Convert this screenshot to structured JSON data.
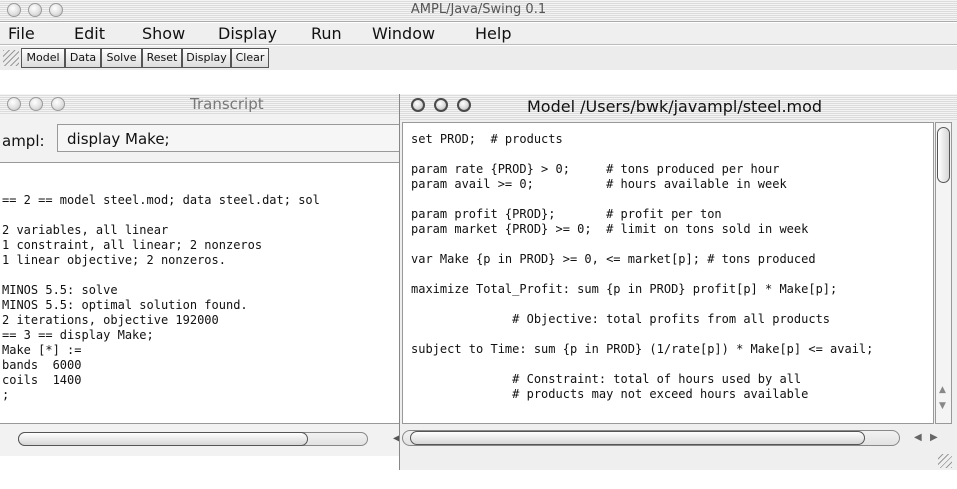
{
  "app": {
    "title": "AMPL/Java/Swing 0.1"
  },
  "menu": [
    "File",
    "Edit",
    "Show",
    "Display",
    "Run",
    "Window",
    "Help"
  ],
  "toolbar": [
    "Model",
    "Data",
    "Solve",
    "Reset",
    "Display",
    "Clear"
  ],
  "transcript": {
    "title": "Transcript",
    "prompt_label": "ampl:",
    "input_value": "display Make;",
    "lines": [
      "== 2 == model steel.mod; data steel.dat; sol",
      "",
      "2 variables, all linear",
      "1 constraint, all linear; 2 nonzeros",
      "1 linear objective; 2 nonzeros.",
      "",
      "MINOS 5.5: solve",
      "MINOS 5.5: optimal solution found.",
      "2 iterations, objective 192000",
      "== 3 == display Make;",
      "Make [*] :=",
      "bands  6000",
      "coils  1400",
      ";"
    ]
  },
  "model_window": {
    "title": "Model /Users/bwk/javampl/steel.mod",
    "lines": [
      "set PROD;  # products",
      "",
      "param rate {PROD} > 0;     # tons produced per hour",
      "param avail >= 0;          # hours available in week",
      "",
      "param profit {PROD};       # profit per ton",
      "param market {PROD} >= 0;  # limit on tons sold in week",
      "",
      "var Make {p in PROD} >= 0, <= market[p]; # tons produced",
      "",
      "maximize Total_Profit: sum {p in PROD} profit[p] * Make[p];",
      "",
      "              # Objective: total profits from all products",
      "",
      "subject to Time: sum {p in PROD} (1/rate[p]) * Make[p] <= avail;",
      "",
      "              # Constraint: total of hours used by all",
      "              # products may not exceed hours available"
    ]
  }
}
